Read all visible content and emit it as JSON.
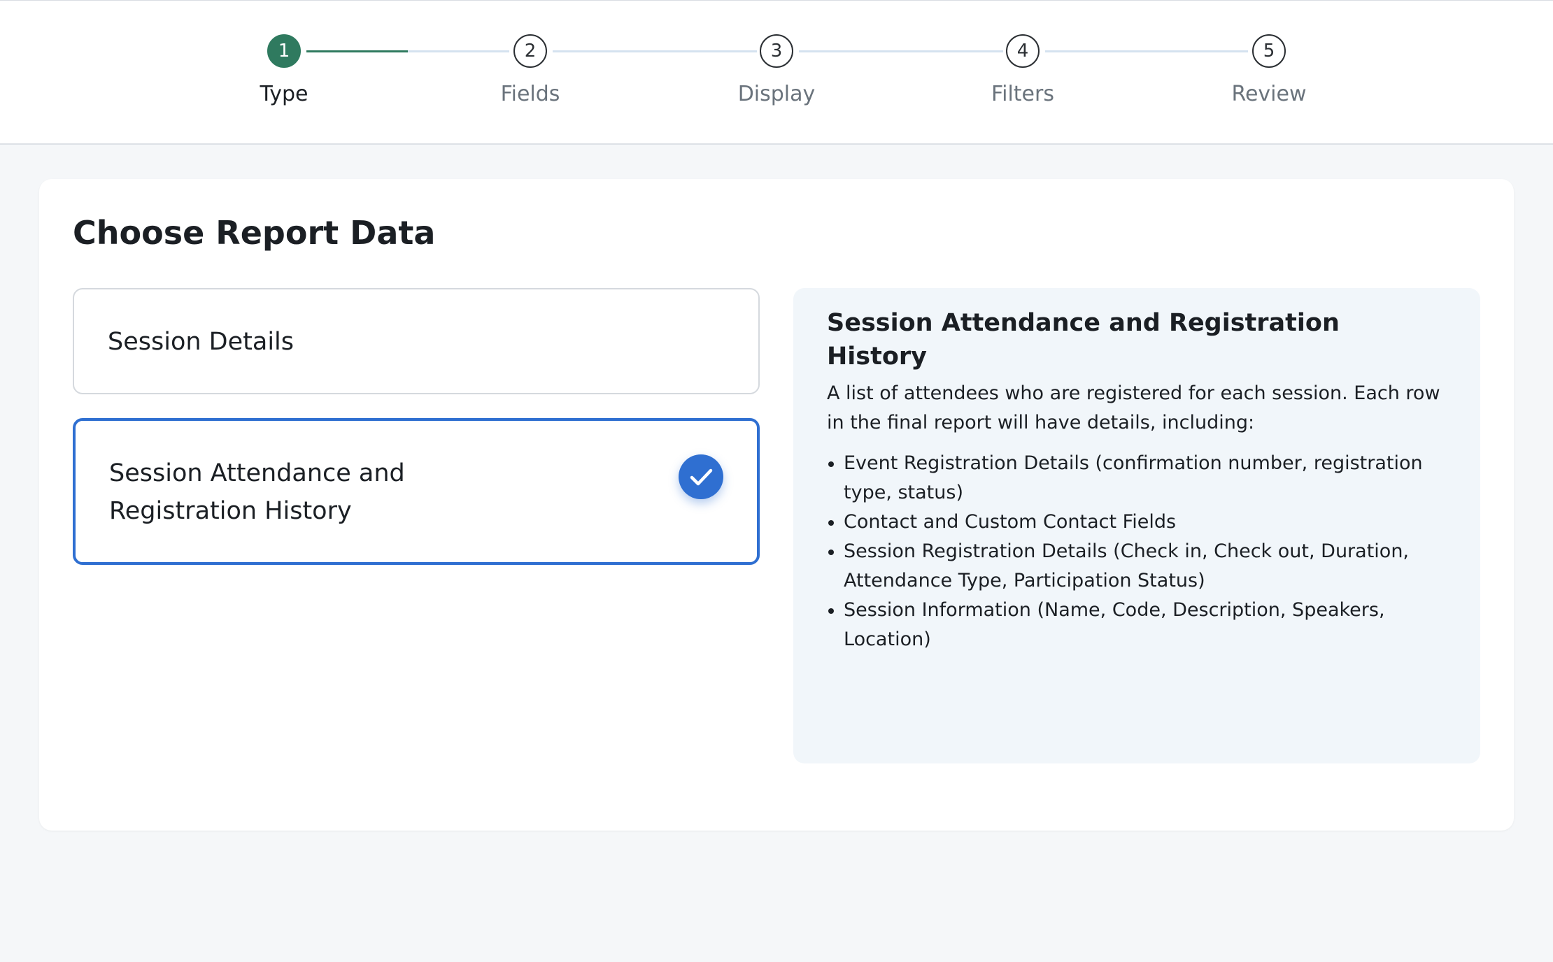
{
  "stepper": {
    "steps": [
      {
        "number": "1",
        "label": "Type",
        "state": "active"
      },
      {
        "number": "2",
        "label": "Fields",
        "state": "pending"
      },
      {
        "number": "3",
        "label": "Display",
        "state": "pending"
      },
      {
        "number": "4",
        "label": "Filters",
        "state": "pending"
      },
      {
        "number": "5",
        "label": "Review",
        "state": "pending"
      }
    ],
    "progress_fraction_of_first_connector": 0.5,
    "colors": {
      "active": "#2f7a5f",
      "connector": "#d4e2ef"
    }
  },
  "main": {
    "title": "Choose Report Data",
    "options": [
      {
        "label": "Session Details",
        "selected": false
      },
      {
        "label_line1": "Session Attendance and",
        "label_line2": "Registration History",
        "selected": true
      }
    ],
    "check_icon": "check-circle-icon",
    "selected_color": "#2f6fd1"
  },
  "description": {
    "title": "Session Attendance and Registration History",
    "body": "A list of attendees who are registered for each session. Each row in the final report will have details, including:",
    "items": [
      "Event Registration Details (confirmation number, registration type, status)",
      "Contact and Custom Contact Fields",
      "Session Registration Details (Check in, Check out, Duration, Attendance Type, Participation Status)",
      "Session Information (Name, Code, Description, Speakers, Location)"
    ]
  }
}
